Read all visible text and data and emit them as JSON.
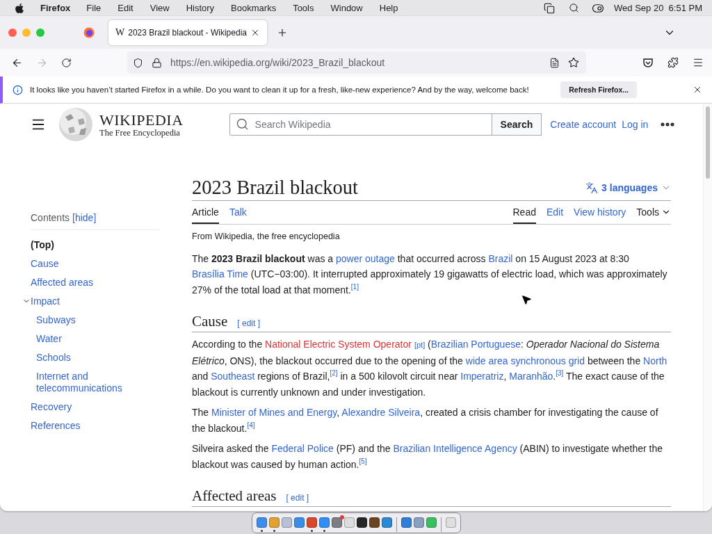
{
  "menu_bar": {
    "app": "Firefox",
    "menus": [
      "File",
      "Edit",
      "View",
      "History",
      "Bookmarks",
      "Tools",
      "Window",
      "Help"
    ],
    "clock": "Wed Sep 20  6:51 PM"
  },
  "tab": {
    "title": "2023 Brazil blackout - Wikipedia",
    "favicon": "W"
  },
  "address_bar": {
    "url": "https://en.wikipedia.org/wiki/2023_Brazil_blackout"
  },
  "notification": {
    "message": "It looks like you haven’t started Firefox in a while. Do you want to clean it up for a fresh, like-new experience? And by the way, welcome back!",
    "button": "Refresh Firefox..."
  },
  "wiki_header": {
    "wordmark": "WIKIPEDIA",
    "tagline": "The Free Encyclopedia",
    "search_placeholder": "Search Wikipedia",
    "search_button": "Search",
    "links": [
      "Create account",
      "Log in"
    ]
  },
  "contents": {
    "title": "Contents",
    "hide": "[hide]",
    "items": [
      {
        "label": "(Top)",
        "selected": true
      },
      {
        "label": "Cause",
        "selected": false
      },
      {
        "label": "Affected areas",
        "selected": false
      },
      {
        "label": "Impact",
        "selected": false,
        "expanded": true,
        "children": [
          {
            "label": "Subways",
            "selected": false
          },
          {
            "label": "Water",
            "selected": false
          },
          {
            "label": "Schools",
            "selected": false
          },
          {
            "label": "Internet and telecommunications",
            "selected": false
          }
        ]
      },
      {
        "label": "Recovery",
        "selected": false
      },
      {
        "label": "References",
        "selected": false
      }
    ]
  },
  "article": {
    "title": "2023 Brazil blackout",
    "languages": "3 languages",
    "tabs_left": [
      {
        "label": "Article",
        "selected": true
      },
      {
        "label": "Talk",
        "selected": false
      }
    ],
    "tabs_right": [
      {
        "label": "Read",
        "selected": true,
        "kind": "tab"
      },
      {
        "label": "Edit",
        "selected": false,
        "kind": "tab"
      },
      {
        "label": "View history",
        "selected": false,
        "kind": "tab"
      },
      {
        "label": "Tools",
        "selected": false,
        "kind": "menu"
      }
    ],
    "tagline": "From Wikipedia, the free encyclopedia",
    "lead": [
      [
        {
          "kind": "text",
          "text": "The **2023 Brazil blackout** was a "
        },
        {
          "kind": "link",
          "text": "power outage"
        },
        {
          "kind": "text",
          "text": " that occurred across "
        },
        {
          "kind": "link",
          "text": "Brazil"
        },
        {
          "kind": "text",
          "text": " on 15 August 2023 at 8:30 "
        },
        {
          "kind": "link",
          "text": "Brasília Time"
        },
        {
          "kind": "text",
          "text": " (UTC−03:00). It interrupted approximately 19 gigawatts of electric load, which was approximately 27% of the total load at that moment."
        },
        {
          "kind": "ref",
          "text": "[1]"
        }
      ]
    ],
    "sections": [
      {
        "heading": "Cause",
        "edit": "[ edit ]",
        "paragraphs": [
          [
            {
              "kind": "text",
              "text": "According to the "
            },
            {
              "kind": "redlink",
              "text": "National Electric System Operator"
            },
            {
              "kind": "lang",
              "text": "[pt]"
            },
            {
              "kind": "text",
              "text": " ("
            },
            {
              "kind": "link",
              "text": "Brazilian Portuguese"
            },
            {
              "kind": "text",
              "text": ": *Operador Nacional do Sistema Elétrico*, ONS), the blackout occurred due to the opening of the "
            },
            {
              "kind": "link",
              "text": "wide area synchronous grid"
            },
            {
              "kind": "text",
              "text": " between the "
            },
            {
              "kind": "link",
              "text": "North"
            },
            {
              "kind": "text",
              "text": " and "
            },
            {
              "kind": "link",
              "text": "Southeast"
            },
            {
              "kind": "text",
              "text": " regions of Brazil,"
            },
            {
              "kind": "ref",
              "text": "[2]"
            },
            {
              "kind": "text",
              "text": " in a 500 kilovolt circuit near "
            },
            {
              "kind": "link",
              "text": "Imperatriz"
            },
            {
              "kind": "text",
              "text": ", "
            },
            {
              "kind": "link",
              "text": "Maranhão"
            },
            {
              "kind": "text",
              "text": "."
            },
            {
              "kind": "ref",
              "text": "[3]"
            },
            {
              "kind": "text",
              "text": " The exact cause of the blackout is currently unknown and under investigation."
            }
          ],
          [
            {
              "kind": "text",
              "text": "The "
            },
            {
              "kind": "link",
              "text": "Minister of Mines and Energy"
            },
            {
              "kind": "text",
              "text": ", "
            },
            {
              "kind": "link",
              "text": "Alexandre Silveira"
            },
            {
              "kind": "text",
              "text": ", created a crisis chamber for investigating the cause of the blackout."
            },
            {
              "kind": "ref",
              "text": "[4]"
            }
          ],
          [
            {
              "kind": "text",
              "text": "Silveira asked the "
            },
            {
              "kind": "link",
              "text": "Federal Police"
            },
            {
              "kind": "text",
              "text": " (PF) and the "
            },
            {
              "kind": "link",
              "text": "Brazilian Intelligence Agency"
            },
            {
              "kind": "text",
              "text": " (ABIN) to investigate whether the blackout was caused by human action."
            },
            {
              "kind": "ref",
              "text": "[5]"
            }
          ]
        ]
      },
      {
        "heading": "Affected areas",
        "edit": "[ edit ]"
      }
    ]
  },
  "dock": [
    {
      "color": "#3c8cf0",
      "running": true
    },
    {
      "color": "#e3a12f",
      "running": true
    },
    {
      "color": "#b9bfd6",
      "running": false
    },
    {
      "color": "#3a8ee6",
      "running": false
    },
    {
      "color": "#d9482b",
      "running": true
    },
    {
      "color": "#2f8ef5",
      "running": true
    },
    {
      "color": "#7d7d85",
      "running": false,
      "badge": true
    },
    {
      "color": "#dcdcdc",
      "running": false
    },
    {
      "color": "#262626",
      "running": false
    },
    {
      "color": "#6b4420",
      "running": false
    },
    {
      "color": "#2a8ad4",
      "running": false
    },
    {
      "color": "#2f7fd8",
      "running": false,
      "group_start": true
    },
    {
      "color": "#8aa0c0",
      "running": false
    },
    {
      "color": "#38c060",
      "running": false
    },
    {
      "color": "#dedede",
      "running": false,
      "group_start": true
    }
  ]
}
